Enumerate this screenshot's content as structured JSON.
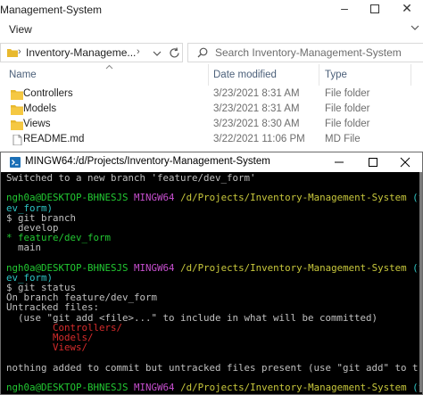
{
  "explorer": {
    "title": "Management-System",
    "ribbon_tab": "View",
    "address": {
      "segments": [
        "Inventory-Manageme..."
      ]
    },
    "search": {
      "placeholder": "Search Inventory-Management-System"
    },
    "columns": {
      "name": "Name",
      "date": "Date modified",
      "type": "Type"
    },
    "files": [
      {
        "name": "Controllers",
        "date": "3/23/2021 8:31 AM",
        "type": "File folder",
        "icon": "folder-icon"
      },
      {
        "name": "Models",
        "date": "3/23/2021 8:31 AM",
        "type": "File folder",
        "icon": "folder-icon"
      },
      {
        "name": "Views",
        "date": "3/23/2021 8:30 AM",
        "type": "File folder",
        "icon": "folder-icon"
      },
      {
        "name": "README.md",
        "date": "3/22/2021 11:06 PM",
        "type": "MD File",
        "icon": "document-icon"
      }
    ]
  },
  "terminal": {
    "title": "MINGW64:/d/Projects/Inventory-Management-System",
    "lines": {
      "l1": "Switched to a new branch 'feature/dev_form'",
      "user": "ngh0a@DESKTOP-BHNESJS",
      "env": "MINGW64",
      "path": "/d/Projects/Inventory-Management-System",
      "branch_open": "(feature/d",
      "branch_close": "ev_form)",
      "cmd1": "$ git branch",
      "b_develop": "  develop",
      "b_feature": "* feature/dev_form",
      "b_main": "  main",
      "cmd2": "$ git status",
      "s1": "On branch feature/dev_form",
      "s2": "Untracked files:",
      "s3": "  (use \"git add <file>...\" to include in what will be committed)",
      "u1": "        Controllers/",
      "u2": "        Models/",
      "u3": "        Views/",
      "s4": "nothing added to commit but untracked files present (use \"git add\" to track)",
      "prompt": "$ "
    }
  },
  "colors": {
    "terminal_bg": "#000000",
    "prompt_user": "#22c832",
    "prompt_env": "#c84fd0",
    "prompt_path": "#c8c83c",
    "prompt_branch": "#2ec5c5",
    "untracked": "#d62b2b",
    "folder": "#e8b92f"
  }
}
